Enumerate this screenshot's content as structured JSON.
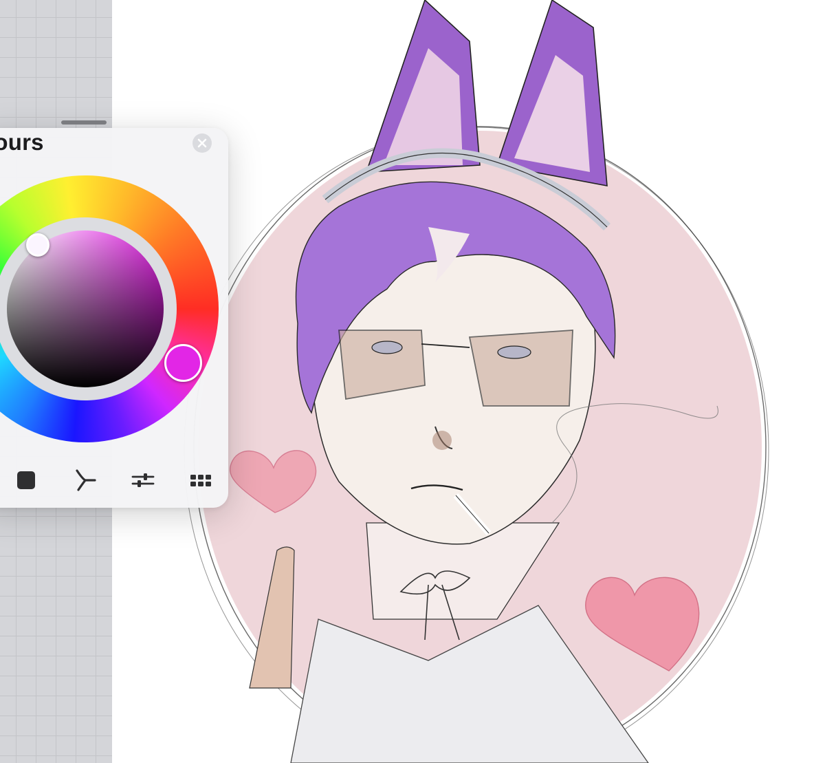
{
  "colours_panel": {
    "title": "lours",
    "tabs": [
      {
        "name": "disc",
        "icon": "square-swatch-icon"
      },
      {
        "name": "classic",
        "icon": "harmony-icon"
      },
      {
        "name": "value",
        "icon": "sliders-icon"
      },
      {
        "name": "palettes",
        "icon": "grid-icon"
      }
    ]
  },
  "current_color": "#e226e6",
  "accent": "#e226e6"
}
